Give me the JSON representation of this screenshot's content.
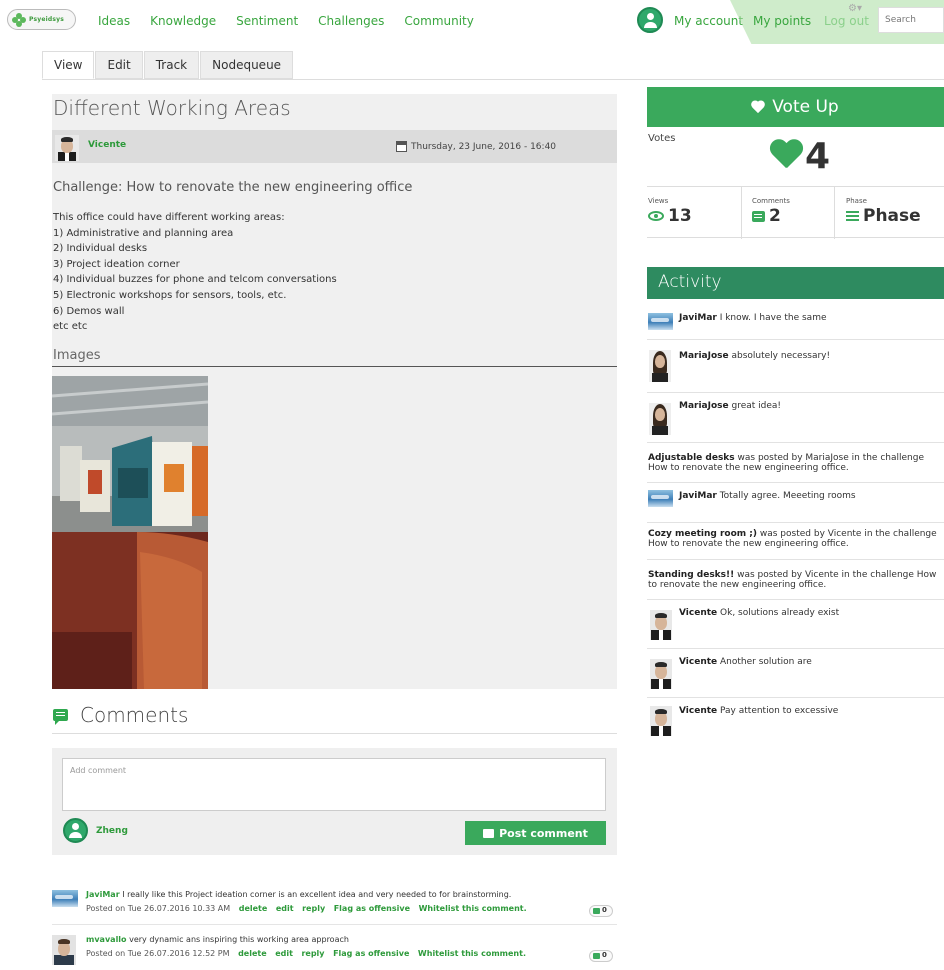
{
  "nav": {
    "logo_text": "Psyeidsys",
    "items": [
      "Ideas",
      "Knowledge",
      "Sentiment",
      "Challenges",
      "Community"
    ],
    "my_account": "My account",
    "my_points": "My points",
    "log_out": "Log out",
    "search_placeholder": "Search"
  },
  "tabs": [
    "View",
    "Edit",
    "Track",
    "Nodequeue"
  ],
  "idea": {
    "title": "Different Working Areas",
    "author": "Vicente",
    "date": "Thursday, 23 June, 2016 - 16:40",
    "challenge": "Challenge:  How to renovate the new engineering office",
    "body": [
      "This office could have different working areas:",
      "1) Administrative and planning area",
      "2) Individual desks",
      "3) Project ideation corner",
      "4) Individual buzzes for phone and telcom conversations",
      "5) Electronic workshops for sensors, tools, etc.",
      "6) Demos wall",
      "etc etc"
    ],
    "images_heading": "Images"
  },
  "comments": {
    "title": "Comments",
    "placeholder": "Add comment",
    "current_user": "Zheng",
    "post_label": "Post comment",
    "items": [
      {
        "author": "JaviMar",
        "text": "I really like this Project ideation corner is an excellent idea and very needed to for brainstorming.",
        "posted": "Posted on Tue 26.07.2016 10.33 AM",
        "actions": [
          "delete",
          "edit",
          "reply",
          "Flag as offensive",
          "Whitelist this comment."
        ],
        "likes": "0"
      },
      {
        "author": "mvavallo",
        "text": "very dynamic ans inspiring this working area approach",
        "posted": "Posted on Tue 26.07.2016 12.52 PM",
        "actions": [
          "delete",
          "edit",
          "reply",
          "Flag as offensive",
          "Whitelist this comment."
        ],
        "likes": "0"
      }
    ]
  },
  "sidebar": {
    "vote_label": "Vote Up",
    "votes_label": "Votes",
    "votes_count": "4",
    "stats": [
      {
        "label": "Views",
        "value": "13"
      },
      {
        "label": "Comments",
        "value": "2"
      },
      {
        "label": "Phase",
        "value": "Phase"
      }
    ],
    "activity_title": "Activity",
    "activity": [
      {
        "bold": "JaviMar",
        "text": " I know. I have the same"
      },
      {
        "bold": "MariaJose",
        "text": " absolutely necessary!"
      },
      {
        "bold": "MariaJose",
        "text": " great idea!"
      },
      {
        "bold": "Adjustable desks",
        "text": " was posted by MariaJose in the challenge How to renovate the new engineering office."
      },
      {
        "bold": "JaviMar",
        "text": " Totally agree. Meeeting rooms"
      },
      {
        "bold": "Cozy meeting room ;)",
        "text": " was posted by Vicente in the challenge How to renovate the new engineering office."
      },
      {
        "bold": "Standing desks!!",
        "text": " was posted by Vicente in the challenge How to renovate the new engineering office."
      },
      {
        "bold": "Vicente",
        "text": " Ok, solutions already exist"
      },
      {
        "bold": "Vicente",
        "text": " Another solution are"
      },
      {
        "bold": "Vicente",
        "text": " Pay attention to excessive"
      }
    ]
  },
  "colors": {
    "brand_green": "#3aa95c",
    "activity_header": "#2e8b60",
    "link_green": "#39a63f"
  }
}
